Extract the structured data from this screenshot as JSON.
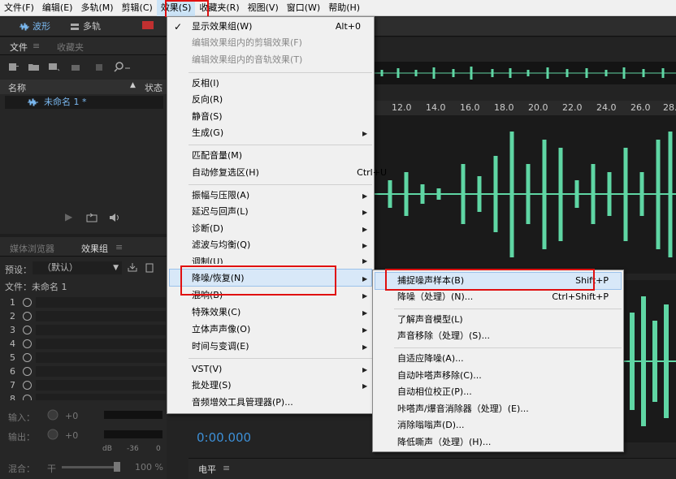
{
  "menubar": {
    "items": [
      "文件(F)",
      "编辑(E)",
      "多轨(M)",
      "剪辑(C)",
      "效果(S)",
      "收藏夹(R)",
      "视图(V)",
      "窗口(W)",
      "帮助(H)"
    ]
  },
  "toolbar": {
    "waveform": "波形",
    "multitrack": "多轨"
  },
  "files_panel": {
    "tab_files": "文件",
    "tab_favorites": "收藏夹",
    "col_name": "名称",
    "col_status": "状态",
    "file_name": "未命名 1 *"
  },
  "effects_panel": {
    "tab_media": "媒体浏览器",
    "tab_rack": "效果组",
    "preset_label": "预设：",
    "preset_value": "（默认）",
    "file_label": "文件：未命名 1",
    "slots": [
      "1",
      "2",
      "3",
      "4",
      "5",
      "6",
      "7",
      "8"
    ],
    "input_label": "输入：",
    "input_value": "+0",
    "output_label": "输出：",
    "output_value": "+0",
    "db_label": "dB",
    "db_scale": [
      "-36",
      "0"
    ],
    "mix_label": "混合：",
    "mix_dry": "干",
    "mix_pct": "100 %"
  },
  "ruler": {
    "ticks": [
      "12.0",
      "14.0",
      "16.0",
      "18.0",
      "20.0",
      "22.0",
      "24.0",
      "26.0",
      "28."
    ]
  },
  "timecode": "0:00.000",
  "level_panel": {
    "title": "电平"
  },
  "effects_menu": {
    "items": [
      {
        "label": "显示效果组(W)",
        "shortcut": "Alt+0",
        "checked": "✓"
      },
      {
        "label": "编辑效果组内的剪辑效果(F)",
        "disabled": true
      },
      {
        "label": "编辑效果组内的音轨效果(T)",
        "disabled": true
      },
      {
        "label": "反相(I)"
      },
      {
        "label": "反向(R)"
      },
      {
        "label": "静音(S)"
      },
      {
        "label": "生成(G)",
        "sub": true
      },
      {
        "label": "匹配音量(M)"
      },
      {
        "label": "自动修复选区(H)",
        "shortcut": "Ctrl+U"
      },
      {
        "label": "振幅与压限(A)",
        "sub": true
      },
      {
        "label": "延迟与回声(L)",
        "sub": true
      },
      {
        "label": "诊断(D)",
        "sub": true
      },
      {
        "label": "滤波与均衡(Q)",
        "sub": true
      },
      {
        "label": "调制(U)",
        "sub": true
      },
      {
        "label": "降噪/恢复(N)",
        "sub": true
      },
      {
        "label": "混响(B)",
        "sub": true
      },
      {
        "label": "特殊效果(C)",
        "sub": true
      },
      {
        "label": "立体声声像(O)",
        "sub": true
      },
      {
        "label": "时间与变调(E)",
        "sub": true
      },
      {
        "label": "VST(V)",
        "sub": true
      },
      {
        "label": "批处理(S)",
        "sub": true
      },
      {
        "label": "音频增效工具管理器(P)..."
      }
    ]
  },
  "noise_submenu": {
    "items": [
      {
        "label": "捕捉噪声样本(B)",
        "shortcut": "Shift+P"
      },
      {
        "label": "降噪（处理）(N)...",
        "shortcut": "Ctrl+Shift+P"
      },
      {
        "label": "了解声音模型(L)"
      },
      {
        "label": "声音移除（处理）(S)..."
      },
      {
        "label": "自适应降噪(A)..."
      },
      {
        "label": "自动咔嗒声移除(C)..."
      },
      {
        "label": "自动相位校正(P)..."
      },
      {
        "label": "咔嗒声/爆音消除器（处理）(E)..."
      },
      {
        "label": "消除嗡嗡声(D)..."
      },
      {
        "label": "降低嘶声（处理）(H)..."
      }
    ]
  },
  "colors": {
    "waveform": "#5fd6a4",
    "highlight": "#e01010",
    "accent": "#3d8fd6"
  }
}
